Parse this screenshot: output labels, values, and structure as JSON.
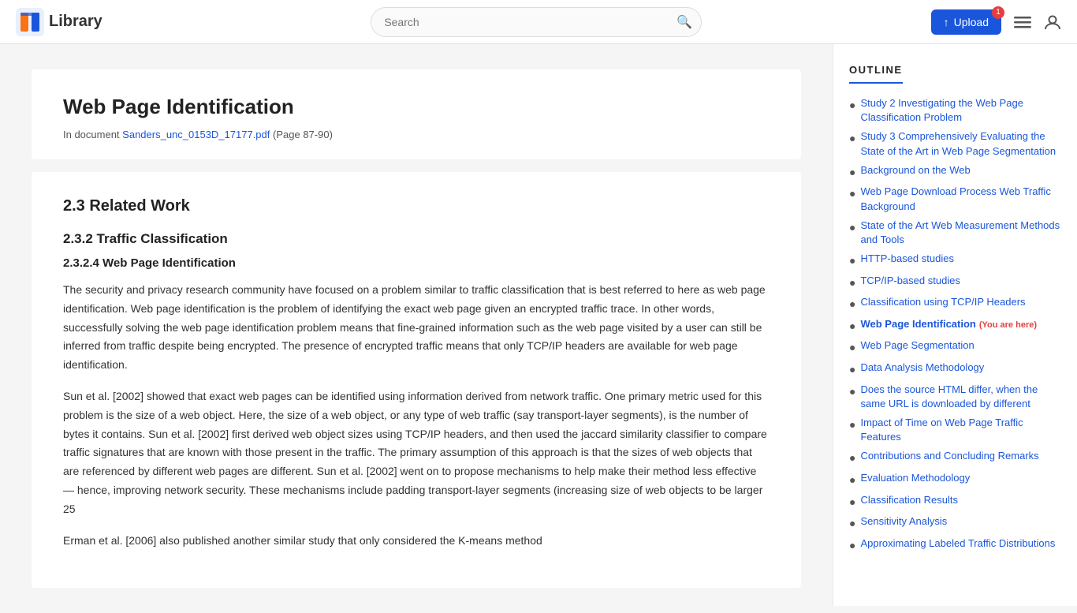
{
  "header": {
    "logo_text": "Library",
    "search_placeholder": "Search",
    "upload_label": "Upload",
    "upload_badge": "1",
    "upload_arrow": "↑"
  },
  "document": {
    "title": "Web Page Identification",
    "meta_prefix": "In document",
    "doc_link_text": "Sanders_unc_0153D_17177.pdf",
    "doc_pages": "(Page 87-90)",
    "section_2_3": "2.3 Related Work",
    "section_2_3_2": "2.3.2 Traffic Classification",
    "section_2_3_2_4": "2.3.2.4 Web Page Identification",
    "paragraph_1": "The security and privacy research community have focused on a problem similar to traffic classification that is best referred to here as web page identification. Web page identification is the problem of identifying the exact web page given an encrypted traffic trace. In other words, successfully solving the web page identification problem means that fine-grained information such as the web page visited by a user can still be inferred from traffic despite being encrypted. The presence of encrypted traffic means that only TCP/IP headers are available for web page identification.",
    "paragraph_2": "Sun et al. [2002] showed that exact web pages can be identified using information derived from network traffic. One primary metric used for this problem is the size of a web object. Here, the size of a web object, or any type of web traffic (say transport-layer segments), is the number of bytes it contains. Sun et al. [2002] first derived web object sizes using TCP/IP headers, and then used the jaccard similarity classifier to compare traffic signatures that are known with those present in the traffic. The primary assumption of this approach is that the sizes of web objects that are referenced by different web pages are different. Sun et al. [2002] went on to propose mechanisms to help make their method less effective — hence, improving network security. These mechanisms include padding transport-layer segments (increasing size of web objects to be larger 25",
    "paragraph_3_start": "Erman et al. [2006] also published another similar study that only considered the K-means method"
  },
  "outline": {
    "title": "OUTLINE",
    "items": [
      {
        "id": "study2",
        "label": "Study 2 Investigating the Web Page Classification Problem",
        "current": false
      },
      {
        "id": "study3",
        "label": "Study 3 Comprehensively Evaluating the State of the Art in Web Page Segmentation",
        "current": false
      },
      {
        "id": "background",
        "label": "Background on the Web",
        "current": false
      },
      {
        "id": "download",
        "label": "Web Page Download Process Web Traffic Background",
        "current": false
      },
      {
        "id": "stateart",
        "label": "State of the Art Web Measurement Methods and Tools",
        "current": false
      },
      {
        "id": "http",
        "label": "HTTP-based studies",
        "current": false
      },
      {
        "id": "tcpip",
        "label": "TCP/IP-based studies",
        "current": false
      },
      {
        "id": "classification",
        "label": "Classification using TCP/IP Headers",
        "current": false
      },
      {
        "id": "webpageid",
        "label": "Web Page Identification",
        "current": true,
        "you_are_here": "(You are here)"
      },
      {
        "id": "segmentation",
        "label": "Web Page Segmentation",
        "current": false
      },
      {
        "id": "dataanalysis",
        "label": "Data Analysis Methodology",
        "current": false
      },
      {
        "id": "sourcediff",
        "label": "Does the source HTML differ, when the same URL is downloaded by different",
        "current": false
      },
      {
        "id": "impacttime",
        "label": "Impact of Time on Web Page Traffic Features",
        "current": false
      },
      {
        "id": "contributions",
        "label": "Contributions and Concluding Remarks",
        "current": false
      },
      {
        "id": "evalmeth",
        "label": "Evaluation Methodology",
        "current": false
      },
      {
        "id": "classresults",
        "label": "Classification Results",
        "current": false
      },
      {
        "id": "sensitivity",
        "label": "Sensitivity Analysis",
        "current": false
      },
      {
        "id": "approxlabeled",
        "label": "Approximating Labeled Traffic Distributions",
        "current": false
      }
    ]
  }
}
